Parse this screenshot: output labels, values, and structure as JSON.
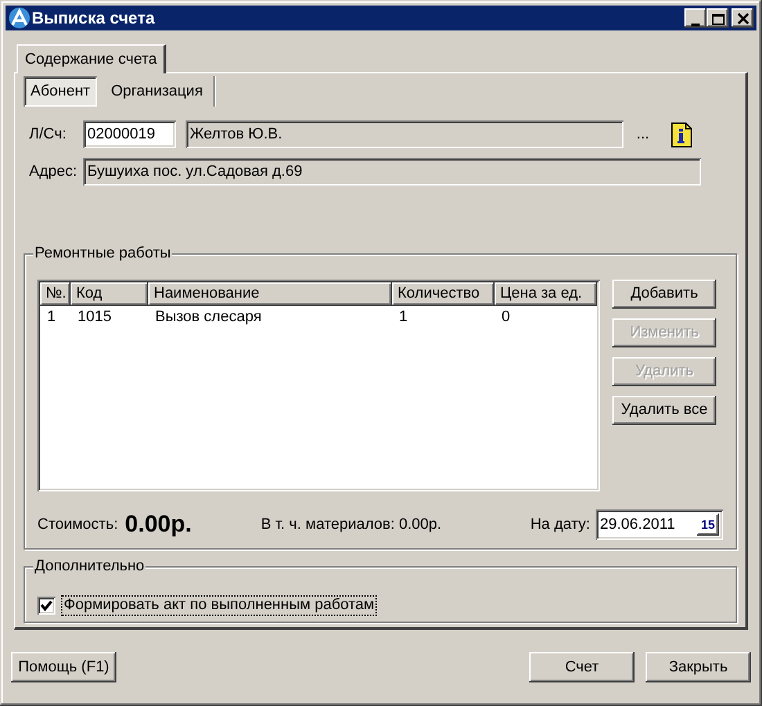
{
  "window": {
    "title": "Выписка счета"
  },
  "tabs": [
    {
      "label": "Содержание счета",
      "selected": true
    }
  ],
  "subtabs": [
    {
      "label": "Абонент",
      "selected": true
    },
    {
      "label": "Организация",
      "selected": false
    }
  ],
  "account": {
    "label": "Л/Сч:",
    "value": "02000019",
    "name": "Желтов Ю.В.",
    "browse": "..."
  },
  "address": {
    "label": "Адрес:",
    "value": "Бушуиха пос. ул.Садовая д.69"
  },
  "repairs": {
    "title": "Ремонтные работы",
    "columns": [
      "№.",
      "Код",
      "Наименование",
      "Количество",
      "Цена за ед."
    ],
    "rows": [
      [
        "1",
        "1015",
        "Вызов слесаря",
        "1",
        "0"
      ]
    ],
    "buttons": [
      {
        "label": "Добавить",
        "disabled": false
      },
      {
        "label": "Изменить",
        "disabled": true
      },
      {
        "label": "Удалить",
        "disabled": true
      },
      {
        "label": "Удалить все",
        "disabled": false
      }
    ]
  },
  "totals": {
    "cost_label": "Стоимость:",
    "cost": "0.00р.",
    "materials": "В т. ч. материалов: 0.00р.",
    "date_label": "На дату:",
    "date": "29.06.2011",
    "calendar": "15"
  },
  "extra": {
    "title": "Дополнительно",
    "checkbox": {
      "label": "Формировать акт по выполненным работам",
      "checked": true
    }
  },
  "footer_buttons": [
    "Помощь (F1)",
    "Счет",
    "Закрыть"
  ]
}
